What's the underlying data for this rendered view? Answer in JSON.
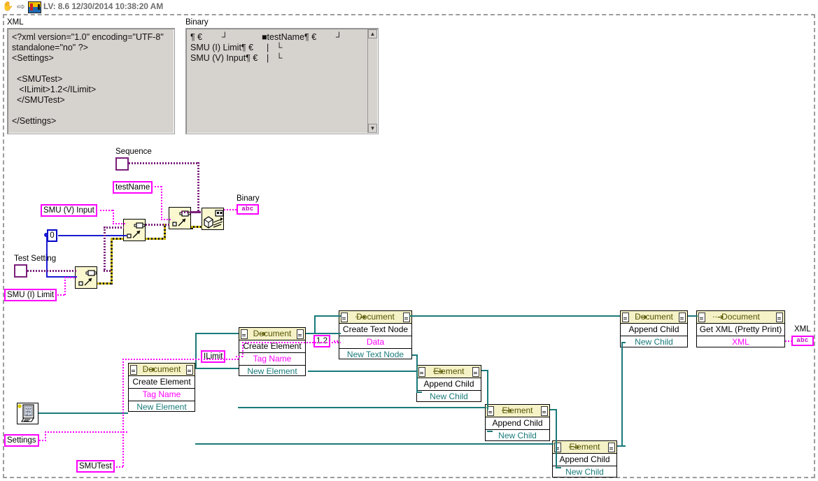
{
  "toolbar": {
    "icons": [
      "hand-cursor-icon",
      "run-arrow-icon",
      "labview-vi-icon"
    ],
    "hand_glyph": "✋",
    "arrow_glyph": "⇨",
    "title": "LV: 8.6 12/30/2014 10:38:20 AM"
  },
  "panes": {
    "xml": {
      "label": "XML",
      "text": "<?xml version=\"1.0\" encoding=\"UTF-8\"\nstandalone=\"no\" ?>\n<Settings>\n\n  <SMUTest>\n   <ILimit>1.2</ILimit>\n  </SMUTest>\n\n</Settings>"
    },
    "binary": {
      "label": "Binary",
      "col1": "¶ €        ┘\nSMU (I) Limit¶ €\nSMU (V) Input¶ €",
      "col2": "■testName¶ €        ┘\n  |   └\n  |   └",
      "scroll_up": "▲",
      "scroll_down": "▼"
    }
  },
  "diagram": {
    "labels": {
      "sequence": "Sequence",
      "test_name": "testName",
      "smu_v_input": "SMU (V) Input",
      "zero": "0",
      "test_setting": "Test Setting",
      "smu_i_limit": "SMU (I) Limit",
      "binary_out": "Binary",
      "binary_indicator": "abc",
      "settings": "Settings",
      "smutest": "SMUTest",
      "ilimit": "ILimit",
      "value_12": "1.2",
      "xml_out": "XML",
      "xml_indicator": "abc"
    },
    "nodes": [
      {
        "id": "create-element-settings",
        "header": "Document",
        "rows": [
          {
            "text": "Create Element",
            "style": "black"
          },
          {
            "text": "Tag Name",
            "style": "pink"
          },
          {
            "text": "New Element",
            "style": "teal"
          }
        ]
      },
      {
        "id": "create-element-smutest",
        "header": "Document",
        "rows": [
          {
            "text": "Create Element",
            "style": "black"
          },
          {
            "text": "Tag Name",
            "style": "pink"
          },
          {
            "text": "New Element",
            "style": "teal"
          }
        ]
      },
      {
        "id": "create-element-ilimit",
        "header": "Document",
        "rows": [
          {
            "text": "Create Element",
            "style": "black"
          },
          {
            "text": "Tag Name",
            "style": "pink"
          },
          {
            "text": "New Element",
            "style": "teal"
          }
        ]
      },
      {
        "id": "create-text-node",
        "header": "Document",
        "rows": [
          {
            "text": "Create Text Node",
            "style": "black"
          },
          {
            "text": "Data",
            "style": "pink"
          },
          {
            "text": "New Text Node",
            "style": "teal"
          }
        ]
      },
      {
        "id": "append-child-element-1",
        "header": "Element",
        "rows": [
          {
            "text": "Append Child",
            "style": "black"
          },
          {
            "text": "New Child",
            "style": "teal"
          }
        ]
      },
      {
        "id": "append-child-element-2",
        "header": "Element",
        "rows": [
          {
            "text": "Append Child",
            "style": "black"
          },
          {
            "text": "New Child",
            "style": "teal"
          }
        ]
      },
      {
        "id": "append-child-element-3",
        "header": "Element",
        "rows": [
          {
            "text": "Append Child",
            "style": "black"
          },
          {
            "text": "New Child",
            "style": "teal"
          }
        ]
      },
      {
        "id": "append-child-document",
        "header": "Document",
        "rows": [
          {
            "text": "Append Child",
            "style": "black"
          },
          {
            "text": "New Child",
            "style": "teal"
          }
        ]
      },
      {
        "id": "get-xml-pretty-print",
        "header": "Document",
        "rows": [
          {
            "text": "Get XML (Pretty Print)",
            "style": "black"
          },
          {
            "text": "XML",
            "style": "pink"
          }
        ]
      }
    ],
    "icon_names": [
      "new-xml-document-icon",
      "variant-to-flattened-string-icon",
      "bundle-cluster-icon",
      "flatten-to-string-icon"
    ]
  },
  "colors": {
    "node_header": "#f6f2c8",
    "subvi_body": "#fbf8d0",
    "string_wire": "#ff00ff",
    "refnum_wire": "#1a7a7a",
    "numeric_wire": "#1a1ad0",
    "cluster_wire": "#7a1f7a",
    "variant_wire": "#bfae00",
    "pane_bg": "#d6d2ce",
    "frame": "#9c9c9c"
  }
}
